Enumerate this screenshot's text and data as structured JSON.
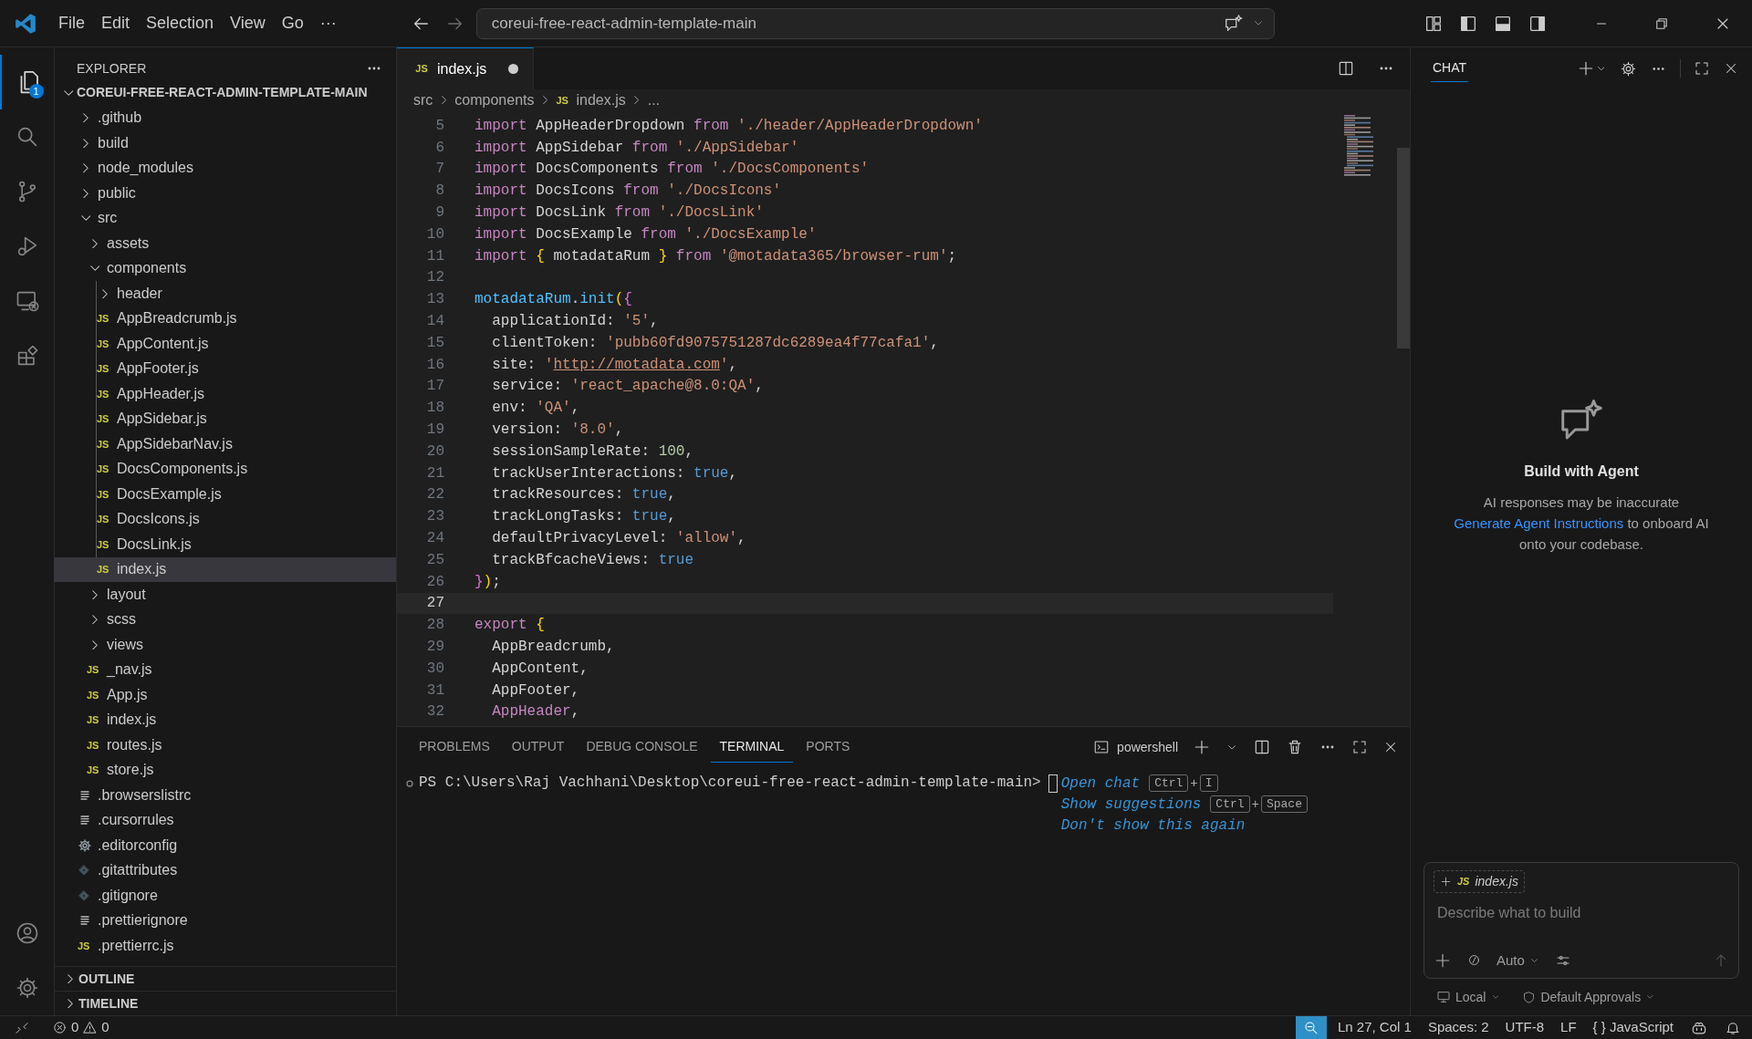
{
  "title_bar": {
    "menu": [
      "File",
      "Edit",
      "Selection",
      "View",
      "Go",
      "···"
    ],
    "command_center": "coreui-free-react-admin-template-main"
  },
  "activity_bar": {
    "badge": "1"
  },
  "explorer": {
    "title": "EXPLORER",
    "root": {
      "name": "COREUI-FREE-REACT-ADMIN-TEMPLATE-MAIN",
      "expanded": true
    },
    "items": [
      {
        "name": ".github",
        "kind": "folder",
        "expanded": false,
        "selected": false
      },
      {
        "name": "build",
        "kind": "folder",
        "expanded": false,
        "selected": false
      },
      {
        "name": "node_modules",
        "kind": "folder",
        "expanded": false,
        "selected": false
      },
      {
        "name": "public",
        "kind": "folder",
        "expanded": false,
        "selected": false
      },
      {
        "name": "src",
        "kind": "folder",
        "expanded": true,
        "selected": false,
        "children": [
          {
            "name": "assets",
            "kind": "folder",
            "expanded": false,
            "selected": false
          },
          {
            "name": "components",
            "kind": "folder",
            "expanded": true,
            "selected": false,
            "children": [
              {
                "name": "header",
                "kind": "folder",
                "expanded": false,
                "selected": false
              },
              {
                "name": "AppBreadcrumb.js",
                "kind": "js",
                "icon": "JS",
                "selected": false
              },
              {
                "name": "AppContent.js",
                "kind": "js",
                "icon": "JS",
                "selected": false
              },
              {
                "name": "AppFooter.js",
                "kind": "js",
                "icon": "JS",
                "selected": false
              },
              {
                "name": "AppHeader.js",
                "kind": "js",
                "icon": "JS",
                "selected": false
              },
              {
                "name": "AppSidebar.js",
                "kind": "js",
                "icon": "JS",
                "selected": false
              },
              {
                "name": "AppSidebarNav.js",
                "kind": "js",
                "icon": "JS",
                "selected": false
              },
              {
                "name": "DocsComponents.js",
                "kind": "js",
                "icon": "JS",
                "selected": false
              },
              {
                "name": "DocsExample.js",
                "kind": "js",
                "icon": "JS",
                "selected": false
              },
              {
                "name": "DocsIcons.js",
                "kind": "js",
                "icon": "JS",
                "selected": false
              },
              {
                "name": "DocsLink.js",
                "kind": "js",
                "icon": "JS",
                "selected": false
              },
              {
                "name": "index.js",
                "kind": "js",
                "icon": "JS",
                "selected": true
              }
            ]
          },
          {
            "name": "layout",
            "kind": "folder",
            "expanded": false,
            "selected": false
          },
          {
            "name": "scss",
            "kind": "folder",
            "expanded": false,
            "selected": false
          },
          {
            "name": "views",
            "kind": "folder",
            "expanded": false,
            "selected": false
          },
          {
            "name": "_nav.js",
            "kind": "js",
            "icon": "JS",
            "selected": false
          },
          {
            "name": "App.js",
            "kind": "js",
            "icon": "JS",
            "selected": false
          },
          {
            "name": "index.js",
            "kind": "js",
            "icon": "JS",
            "selected": false
          },
          {
            "name": "routes.js",
            "kind": "js",
            "icon": "JS",
            "selected": false
          },
          {
            "name": "store.js",
            "kind": "js",
            "icon": "JS",
            "selected": false
          }
        ]
      },
      {
        "name": ".browserslistrc",
        "kind": "lines",
        "selected": false
      },
      {
        "name": ".cursorrules",
        "kind": "lines",
        "selected": false
      },
      {
        "name": ".editorconfig",
        "kind": "gear",
        "selected": false
      },
      {
        "name": ".gitattributes",
        "kind": "git",
        "selected": false
      },
      {
        "name": ".gitignore",
        "kind": "git",
        "selected": false
      },
      {
        "name": ".prettierignore",
        "kind": "lines",
        "selected": false
      },
      {
        "name": ".prettierrc.js",
        "kind": "js",
        "icon": "JS",
        "selected": false
      }
    ],
    "sections": [
      {
        "name": "OUTLINE",
        "expanded": false
      },
      {
        "name": "TIMELINE",
        "expanded": false
      }
    ]
  },
  "editor": {
    "tabs": [
      {
        "label": "index.js",
        "icon": "JS",
        "modified": true,
        "selected": true
      }
    ],
    "breadcrumb": [
      {
        "text": "src"
      },
      {
        "text": "components"
      },
      {
        "text": "index.js",
        "icon": "JS"
      },
      {
        "text": "..."
      }
    ],
    "lines": [
      {
        "number": "5",
        "current": false,
        "tokens": [
          {
            "kind": "keyword",
            "text": "import"
          },
          {
            "kind": "plain",
            "text": " AppHeaderDropdown "
          },
          {
            "kind": "keyword",
            "text": "from "
          },
          {
            "kind": "string",
            "text": "'./header/AppHeaderDropdown'"
          }
        ]
      },
      {
        "number": "6",
        "current": false,
        "tokens": [
          {
            "kind": "keyword",
            "text": "import"
          },
          {
            "kind": "plain",
            "text": " AppSidebar "
          },
          {
            "kind": "keyword",
            "text": "from "
          },
          {
            "kind": "string",
            "text": "'./AppSidebar'"
          }
        ]
      },
      {
        "number": "7",
        "current": false,
        "tokens": [
          {
            "kind": "keyword",
            "text": "import"
          },
          {
            "kind": "plain",
            "text": " DocsComponents "
          },
          {
            "kind": "keyword",
            "text": "from "
          },
          {
            "kind": "string",
            "text": "'./DocsComponents'"
          }
        ]
      },
      {
        "number": "8",
        "current": false,
        "tokens": [
          {
            "kind": "keyword",
            "text": "import"
          },
          {
            "kind": "plain",
            "text": " DocsIcons "
          },
          {
            "kind": "keyword",
            "text": "from "
          },
          {
            "kind": "string",
            "text": "'./DocsIcons'"
          }
        ]
      },
      {
        "number": "9",
        "current": false,
        "tokens": [
          {
            "kind": "keyword",
            "text": "import"
          },
          {
            "kind": "plain",
            "text": " DocsLink "
          },
          {
            "kind": "keyword",
            "text": "from "
          },
          {
            "kind": "string",
            "text": "'./DocsLink'"
          }
        ]
      },
      {
        "number": "10",
        "current": false,
        "tokens": [
          {
            "kind": "keyword",
            "text": "import"
          },
          {
            "kind": "plain",
            "text": " DocsExample "
          },
          {
            "kind": "keyword",
            "text": "from "
          },
          {
            "kind": "string",
            "text": "'./DocsExample'"
          }
        ]
      },
      {
        "number": "11",
        "current": false,
        "tokens": [
          {
            "kind": "keyword",
            "text": "import "
          },
          {
            "kind": "brace",
            "text": "{"
          },
          {
            "kind": "plain",
            "text": " motadataRum "
          },
          {
            "kind": "brace",
            "text": "}"
          },
          {
            "kind": "keyword",
            "text": " from "
          },
          {
            "kind": "string",
            "text": "'@motadata365/browser-rum'"
          },
          {
            "kind": "plain",
            "text": ";"
          }
        ]
      },
      {
        "number": "12",
        "current": false
      },
      {
        "number": "13",
        "current": false,
        "tokens": [
          {
            "kind": "variable",
            "text": "motadataRum"
          },
          {
            "kind": "plain",
            "text": "."
          },
          {
            "kind": "variable",
            "text": "init"
          },
          {
            "kind": "brace",
            "text": "("
          },
          {
            "kind": "brace2",
            "text": "{"
          }
        ]
      },
      {
        "number": "14",
        "current": false,
        "tokens": [
          {
            "kind": "plain",
            "text": "  applicationId: "
          },
          {
            "kind": "string",
            "text": "'5'"
          },
          {
            "kind": "plain",
            "text": ","
          }
        ]
      },
      {
        "number": "15",
        "current": false,
        "tokens": [
          {
            "kind": "plain",
            "text": "  clientToken: "
          },
          {
            "kind": "string",
            "text": "'pubb60fd9075751287dc6289ea4f77cafa1'"
          },
          {
            "kind": "plain",
            "text": ","
          }
        ]
      },
      {
        "number": "16",
        "current": false,
        "tokens": [
          {
            "kind": "plain",
            "text": "  site: "
          },
          {
            "kind": "string",
            "text": "'"
          },
          {
            "kind": "link",
            "text": "http://motadata.com"
          },
          {
            "kind": "string",
            "text": "'"
          },
          {
            "kind": "plain",
            "text": ","
          }
        ]
      },
      {
        "number": "17",
        "current": false,
        "tokens": [
          {
            "kind": "plain",
            "text": "  service: "
          },
          {
            "kind": "string",
            "text": "'react_apache@8.0:QA'"
          },
          {
            "kind": "plain",
            "text": ","
          }
        ]
      },
      {
        "number": "18",
        "current": false,
        "tokens": [
          {
            "kind": "plain",
            "text": "  env: "
          },
          {
            "kind": "string",
            "text": "'QA'"
          },
          {
            "kind": "plain",
            "text": ","
          }
        ]
      },
      {
        "number": "19",
        "current": false,
        "tokens": [
          {
            "kind": "plain",
            "text": "  version: "
          },
          {
            "kind": "string",
            "text": "'8.0'"
          },
          {
            "kind": "plain",
            "text": ","
          }
        ]
      },
      {
        "number": "20",
        "current": false,
        "tokens": [
          {
            "kind": "plain",
            "text": "  sessionSampleRate: "
          },
          {
            "kind": "number",
            "text": "100"
          },
          {
            "kind": "plain",
            "text": ","
          }
        ]
      },
      {
        "number": "21",
        "current": false,
        "tokens": [
          {
            "kind": "plain",
            "text": "  trackUserInteractions: "
          },
          {
            "kind": "boolean",
            "text": "true"
          },
          {
            "kind": "plain",
            "text": ","
          }
        ]
      },
      {
        "number": "22",
        "current": false,
        "tokens": [
          {
            "kind": "plain",
            "text": "  trackResources: "
          },
          {
            "kind": "boolean",
            "text": "true"
          },
          {
            "kind": "plain",
            "text": ","
          }
        ]
      },
      {
        "number": "23",
        "current": false,
        "tokens": [
          {
            "kind": "plain",
            "text": "  trackLongTasks: "
          },
          {
            "kind": "boolean",
            "text": "true"
          },
          {
            "kind": "plain",
            "text": ","
          }
        ]
      },
      {
        "number": "24",
        "current": false,
        "tokens": [
          {
            "kind": "plain",
            "text": "  defaultPrivacyLevel: "
          },
          {
            "kind": "string",
            "text": "'allow'"
          },
          {
            "kind": "plain",
            "text": ","
          }
        ]
      },
      {
        "number": "25",
        "current": false,
        "tokens": [
          {
            "kind": "plain",
            "text": "  trackBfcacheViews: "
          },
          {
            "kind": "boolean",
            "text": "true"
          }
        ]
      },
      {
        "number": "26",
        "current": false,
        "tokens": [
          {
            "kind": "brace2",
            "text": "}"
          },
          {
            "kind": "brace",
            "text": ")"
          },
          {
            "kind": "plain",
            "text": ";"
          }
        ]
      },
      {
        "number": "27",
        "current": true
      },
      {
        "number": "28",
        "current": false,
        "tokens": [
          {
            "kind": "keyword",
            "text": "export "
          },
          {
            "kind": "brace",
            "text": "{"
          }
        ]
      },
      {
        "number": "29",
        "current": false,
        "tokens": [
          {
            "kind": "plain",
            "text": "  AppBreadcrumb,"
          }
        ]
      },
      {
        "number": "30",
        "current": false,
        "tokens": [
          {
            "kind": "plain",
            "text": "  AppContent,"
          }
        ]
      },
      {
        "number": "31",
        "current": false,
        "tokens": [
          {
            "kind": "plain",
            "text": "  AppFooter,"
          }
        ]
      },
      {
        "number": "32",
        "current": false,
        "tokens": [
          {
            "kind": "highlight",
            "text": "  AppHeader"
          },
          {
            "kind": "plain",
            "text": ","
          }
        ]
      }
    ]
  },
  "panel": {
    "tabs": [
      {
        "label": "PROBLEMS",
        "selected": false
      },
      {
        "label": "OUTPUT",
        "selected": false
      },
      {
        "label": "DEBUG CONSOLE",
        "selected": false
      },
      {
        "label": "TERMINAL",
        "selected": true
      },
      {
        "label": "PORTS",
        "selected": false
      }
    ],
    "shell": "powershell",
    "prompt": "PS C:\\Users\\Raj Vachhani\\Desktop\\coreui-free-react-admin-template-main>",
    "hints": [
      {
        "text": "Open chat",
        "keys": [
          {
            "kind": "key",
            "text": "Ctrl"
          },
          {
            "kind": "plus",
            "text": "+"
          },
          {
            "kind": "key",
            "text": "I"
          }
        ]
      },
      {
        "text": "Show suggestions",
        "keys": [
          {
            "kind": "key",
            "text": "Ctrl"
          },
          {
            "kind": "plus",
            "text": "+"
          },
          {
            "kind": "key",
            "text": "Space"
          }
        ]
      },
      {
        "text": "Don't show this again"
      }
    ]
  },
  "chat": {
    "tabs": [
      {
        "label": "CHAT",
        "selected": true
      }
    ],
    "heading": "Build with Agent",
    "disclaimer": "AI responses may be inaccurate",
    "link": "Generate Agent Instructions",
    "link_rest": " to onboard AI onto your codebase.",
    "context": {
      "icon": "JS",
      "file": "index.js"
    },
    "placeholder": "Describe what to build",
    "mode": "Auto",
    "location": "Local",
    "approvals": "Default Approvals"
  },
  "status_bar": {
    "errors": "0",
    "warnings": "0",
    "position": "Ln 27, Col 1",
    "indent": "Spaces: 2",
    "encoding": "UTF-8",
    "eol": "LF",
    "language_icon": "{ }",
    "language": "JavaScript"
  }
}
